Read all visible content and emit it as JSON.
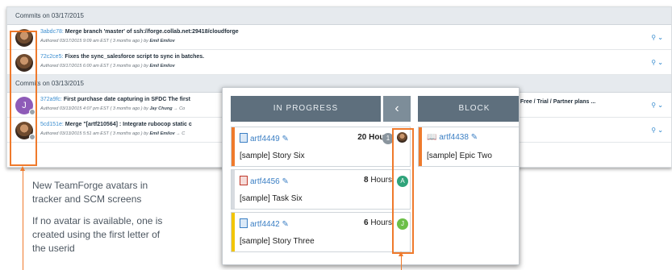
{
  "commits": {
    "groups": [
      {
        "header": "Commits on 03/17/2015",
        "rows": [
          {
            "hash": "3abdc78:",
            "message": "Merge branch 'master' of ssh://forge.collab.net:29418/cloudforge",
            "meta_prefix": "Authored 03/17/2015 9:09 am EST ( 3 months ago ) by",
            "author": "Emil Emilov",
            "meta_suffix": ""
          },
          {
            "hash": "72c2ce5:",
            "message": "Fixes the sync_salesforce script to sync in batches.",
            "meta_prefix": "Authored 03/17/2015 6:00 am EST ( 3 months ago ) by",
            "author": "Emil Emilov",
            "meta_suffix": ""
          }
        ]
      },
      {
        "header": "Commits on 03/13/2015",
        "rows": [
          {
            "hash": "372a9fc:",
            "message": "First purchase date capturing in SFDC The first",
            "meta_prefix": "Authored 03/13/2015 4:07 pm EST ( 3 months ago ) by",
            "author": "Jay Chung",
            "meta_suffix": "→ Co",
            "avatar_letter": "J",
            "extra": "clues Free / Trial / Partner plans ..."
          },
          {
            "hash": "5cd151e:",
            "message": "Merge \"[artf210564] : Integrate rubocop static c",
            "meta_prefix": "Authored 03/13/2015 5:51 am EST ( 3 months ago ) by",
            "author": "Emil Emilov",
            "meta_suffix": "→ C"
          }
        ]
      }
    ],
    "action_icons": "⚲ ⌄"
  },
  "annotation": {
    "line1": "New TeamForge avatars in",
    "line2": "tracker and SCM screens",
    "line3": "If no avatar is available, one is",
    "line4": "created using the first letter of",
    "line5": "the userid"
  },
  "board": {
    "in_progress": "IN PROGRESS",
    "blocked": "BLOCK",
    "collapse": "‹",
    "cards": [
      {
        "id": "artf4449",
        "hours": "20",
        "hours_label": "Hours",
        "count": "1",
        "title": "[sample] Story Six",
        "stripe": "#ef7a2c",
        "pill_color": "#8a959e"
      },
      {
        "id": "artf4456",
        "hours": "8",
        "hours_label": "Hours",
        "count": "A",
        "title": "[sample] Task Six",
        "stripe": "#d7dbe0",
        "pill_color": "#2fa37a"
      },
      {
        "id": "artf4442",
        "hours": "6",
        "hours_label": "Hours",
        "count": "J",
        "title": "[sample] Story Three",
        "stripe": "#f2c500",
        "pill_color": "#6cbf47"
      }
    ],
    "blocked_card": {
      "id": "artf4438",
      "title": "[sample] Epic Two"
    }
  },
  "colors": {
    "accent": "#ef7a2c",
    "link": "#3b8ed0"
  }
}
